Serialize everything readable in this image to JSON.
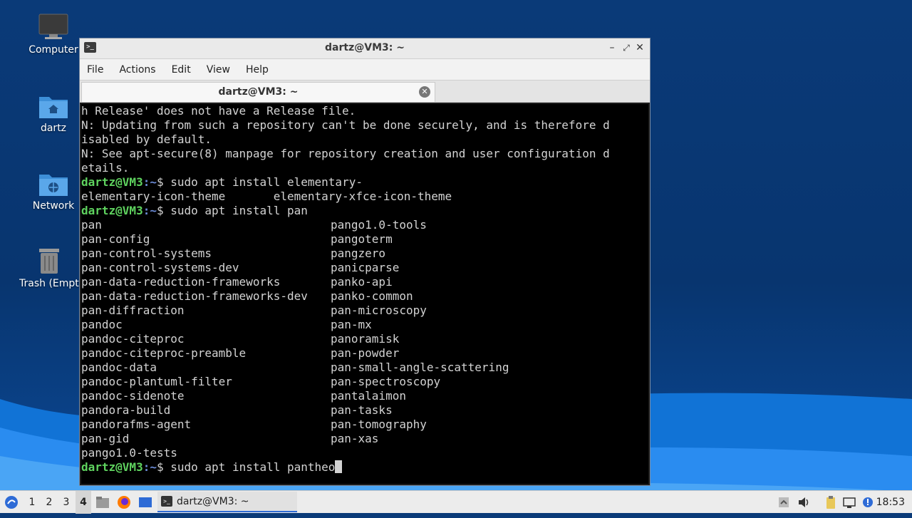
{
  "desktop": {
    "icons": [
      {
        "label": "Computer"
      },
      {
        "label": "dartz"
      },
      {
        "label": "Network"
      },
      {
        "label": "Trash (Empty)"
      }
    ]
  },
  "window": {
    "title": "dartz@VM3: ~",
    "menu": [
      "File",
      "Actions",
      "Edit",
      "View",
      "Help"
    ],
    "tab_label": "dartz@VM3: ~"
  },
  "terminal": {
    "lines": [
      "h Release' does not have a Release file.",
      "N: Updating from such a repository can't be done securely, and is therefore d",
      "isabled by default.",
      "N: See apt-secure(8) manpage for repository creation and user configuration d",
      "etails."
    ],
    "prompt_user": "dartz@VM3",
    "prompt_path": ":~",
    "prompt_symbol": "$",
    "cmd1": " sudo apt install elementary-",
    "completion1": "elementary-icon-theme       elementary-xfce-icon-theme",
    "cmd2": " sudo apt install pan",
    "completions_left": [
      "pan",
      "pan-config",
      "pan-control-systems",
      "pan-control-systems-dev",
      "pan-data-reduction-frameworks",
      "pan-data-reduction-frameworks-dev",
      "pan-diffraction",
      "pandoc",
      "pandoc-citeproc",
      "pandoc-citeproc-preamble",
      "pandoc-data",
      "pandoc-plantuml-filter",
      "pandoc-sidenote",
      "pandora-build",
      "pandorafms-agent",
      "pan-gid",
      "pango1.0-tests"
    ],
    "completions_right": [
      "pango1.0-tools",
      "pangoterm",
      "pangzero",
      "panicparse",
      "panko-api",
      "panko-common",
      "pan-microscopy",
      "pan-mx",
      "panoramisk",
      "pan-powder",
      "pan-small-angle-scattering",
      "pan-spectroscopy",
      "pantalaimon",
      "pan-tasks",
      "pan-tomography",
      "pan-xas",
      ""
    ],
    "cmd3": " sudo apt install pantheo"
  },
  "taskbar": {
    "workspaces": [
      "1",
      "2",
      "3",
      "4"
    ],
    "active_workspace": "4",
    "task_label": "dartz@VM3: ~",
    "clock": "18:53"
  },
  "colors": {
    "prompt_user": "#5fd35f",
    "prompt_path": "#6b8bd6",
    "desktop_bg": "#0a3a78",
    "accent": "#2e6bd6"
  }
}
